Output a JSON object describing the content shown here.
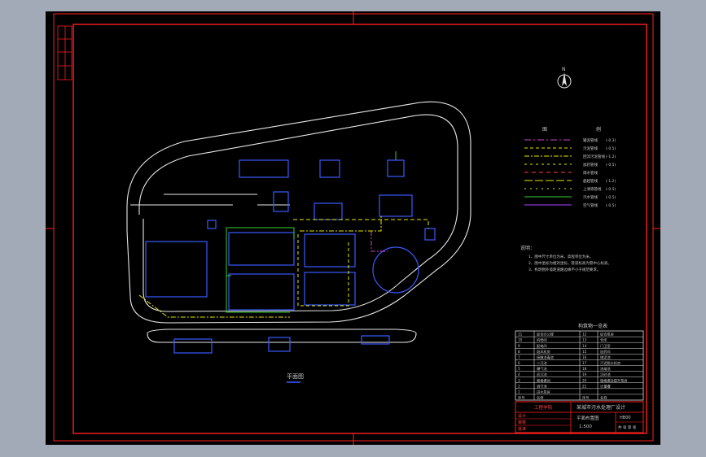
{
  "drawing": {
    "plan_label": "平面图",
    "north_label": "N",
    "legend": {
      "head_left": "图",
      "head_right": "例",
      "rows": [
        {
          "label": "输泥管线",
          "suffix": "(-0.3)",
          "color": "#cc44cc",
          "dash": "8 3 2 3"
        },
        {
          "label": "污泥管线",
          "suffix": "(-0.5)",
          "color": "#e6e600",
          "dash": "4 3"
        },
        {
          "label": "回流污泥管线",
          "suffix": "(-1.2)",
          "color": "#e6e600",
          "dash": "6 2 2 2"
        },
        {
          "label": "加药管线",
          "suffix": "(-0.5)",
          "color": "#e6e600",
          "dash": "3 4"
        },
        {
          "label": "雨水管线",
          "suffix": "",
          "color": "#ff4040",
          "dash": "5 4"
        },
        {
          "label": "超越管线",
          "suffix": "(-1.2)",
          "color": "#e6e600",
          "dash": "10 3"
        },
        {
          "label": "上清液管线",
          "suffix": "(-0.5)",
          "color": "#e6e600",
          "dash": "2 5"
        },
        {
          "label": "污水管线",
          "suffix": "(-0.5)",
          "color": "#33cc33",
          "dash": ""
        },
        {
          "label": "空气管线",
          "suffix": "(-0.5)",
          "color": "#aa44ff",
          "dash": ""
        }
      ]
    },
    "notes": {
      "title": "说明：",
      "items": [
        "1、图中尺寸单位为米，高程单位为米。",
        "2、图中坐标为相对坐标，管道标高为管中心标高。",
        "3、构筑物外墙距道路边缘不小于规范要求。"
      ]
    },
    "table": {
      "title": "构筑物一览表",
      "rows": [
        [
          "11",
          "综合办公楼",
          "12",
          "综合泵房"
        ],
        [
          "10",
          "机修间",
          "13",
          "仓库"
        ],
        [
          "9",
          "配电间",
          "14",
          "门卫室"
        ],
        [
          "8",
          "鼓风机房",
          "15",
          "加药间"
        ],
        [
          "7",
          "接触消毒池",
          "16",
          "储泥池"
        ],
        [
          "6",
          "二沉池",
          "17",
          "污泥脱水机房"
        ],
        [
          "5",
          "曝气池",
          "18",
          "浓缩池"
        ],
        [
          "4",
          "初沉池",
          "19",
          "沉砂池"
        ],
        [
          "3",
          "细格栅间",
          "20",
          "粗格栅及提升泵房"
        ],
        [
          "2",
          "调节池",
          "21",
          "计量槽"
        ],
        [
          "1",
          "进水泵房",
          "",
          ""
        ],
        [
          "序号",
          "名称",
          "序号",
          "名称"
        ]
      ]
    },
    "title_block": {
      "school": "工程学院",
      "title": "某城市污水处理厂设计",
      "drawing_name": "平面布置图",
      "scale": "1:500",
      "number": "HB00",
      "sheet": "共 张 第 张",
      "roles": [
        "设计",
        "审核",
        "批准"
      ]
    }
  }
}
